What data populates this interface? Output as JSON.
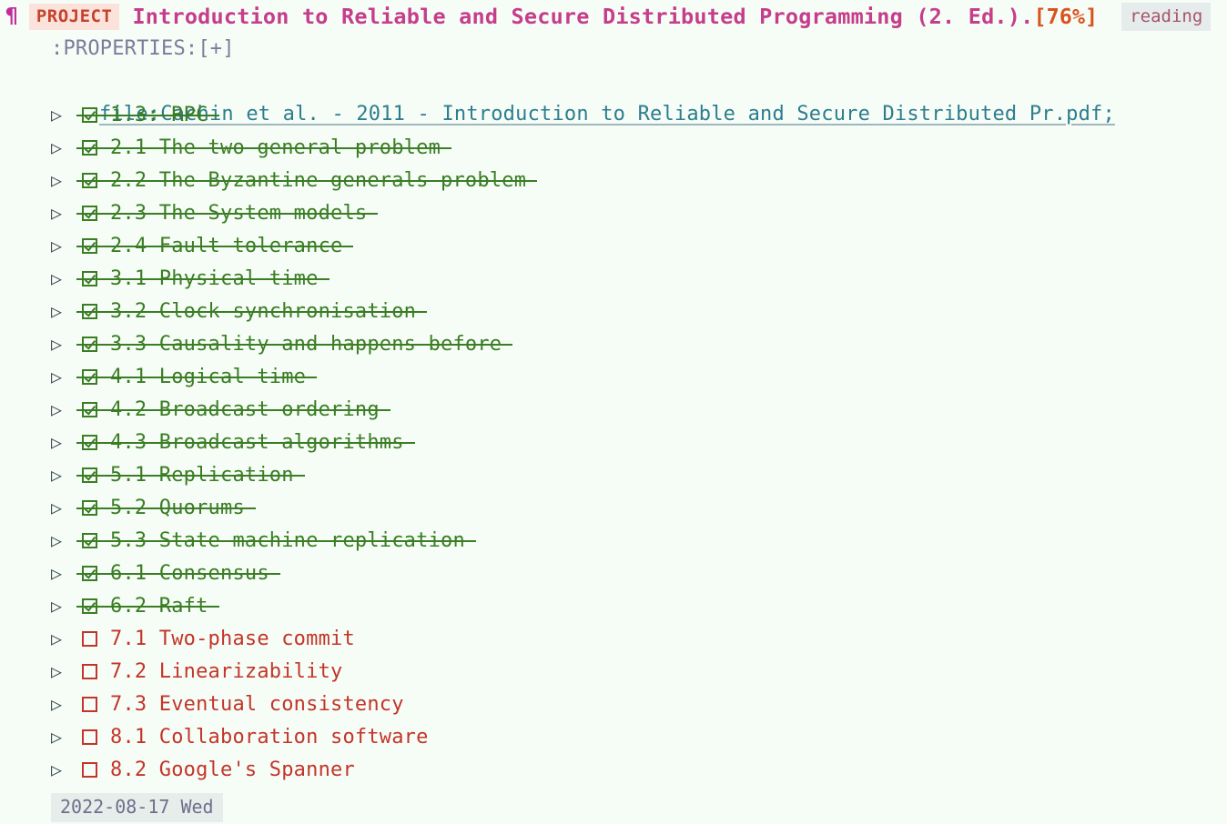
{
  "headline": {
    "paragraph_mark": "¶",
    "keyword": "PROJECT",
    "title": "Introduction to Reliable and Secure Distributed Programming (2. Ed.).",
    "progress": "[76%]",
    "tag": "reading"
  },
  "drawer": {
    "text": ":PROPERTIES:[+]"
  },
  "file_link": {
    "text": "file:Cachin et al. - 2011 - Introduction to Reliable and Secure Distributed Pr.pdf;"
  },
  "icons": {
    "caret": "▷",
    "checkbox_done": "☑",
    "checkbox_todo": "☐"
  },
  "items": [
    {
      "caret": "▷",
      "state": "done",
      "label": "1.3: RPC"
    },
    {
      "caret": "▷",
      "state": "done",
      "label": "2.1 The two general problem"
    },
    {
      "caret": "▷",
      "state": "done",
      "label": "2.2 The Byzantine generals problem"
    },
    {
      "caret": "▷",
      "state": "done",
      "label": "2.3 The System models"
    },
    {
      "caret": "▷",
      "state": "done",
      "label": "2.4 Fault tolerance"
    },
    {
      "caret": "▷",
      "state": "done",
      "label": "3.1 Physical time"
    },
    {
      "caret": "▷",
      "state": "done",
      "label": "3.2 Clock synchronisation"
    },
    {
      "caret": "▷",
      "state": "done",
      "label": "3.3 Causality and happens-before"
    },
    {
      "caret": "▷",
      "state": "done",
      "label": "4.1 Logical time"
    },
    {
      "caret": "▷",
      "state": "done",
      "label": "4.2 Broadcast ordering"
    },
    {
      "caret": "▷",
      "state": "done",
      "label": "4.3 Broadcast algorithms"
    },
    {
      "caret": "▷",
      "state": "done",
      "label": "5.1 Replication"
    },
    {
      "caret": "▷",
      "state": "done",
      "label": "5.2 Quorums"
    },
    {
      "caret": "▷",
      "state": "done",
      "label": "5.3 State machine replication"
    },
    {
      "caret": "▷",
      "state": "done",
      "label": "6.1 Consensus"
    },
    {
      "caret": "▷",
      "state": "done",
      "label": "6.2 Raft"
    },
    {
      "caret": "▷",
      "state": "todo",
      "label": "7.1 Two-phase commit"
    },
    {
      "caret": "▷",
      "state": "todo",
      "label": "7.2 Linearizability"
    },
    {
      "caret": "▷",
      "state": "todo",
      "label": "7.3 Eventual consistency"
    },
    {
      "caret": "▷",
      "state": "todo",
      "label": "8.1 Collaboration software"
    },
    {
      "caret": "▷",
      "state": "todo",
      "label": "8.2 Google's Spanner"
    }
  ],
  "footer": {
    "date": "2022-08-17 Wed"
  },
  "colors": {
    "background": "#f6fdf6",
    "done": "#3a7d24",
    "todo": "#c3352a",
    "title": "#c63d8c",
    "progress": "#d9531e",
    "keyword_fg": "#c5432e",
    "keyword_bg": "#fbe3dc",
    "tag_fg": "#a8546a",
    "tag_bg": "#e6ecec",
    "drawer": "#7b7c9b",
    "link": "#2d7d8f",
    "date_fg": "#6d6f8d",
    "date_bg": "#e7edea"
  }
}
